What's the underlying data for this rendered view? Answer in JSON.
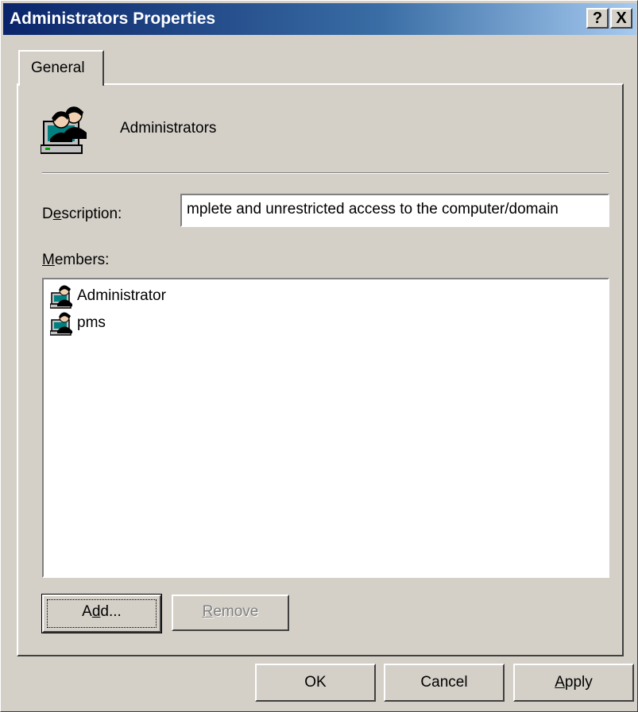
{
  "window": {
    "title": "Administrators Properties",
    "help_button": "?",
    "close_button": "X"
  },
  "tabs": [
    {
      "label": "General",
      "selected": true
    }
  ],
  "general": {
    "group_name": "Administrators",
    "group_icon": "user-group-icon",
    "description_label": "Description:",
    "description_value": "mplete and unrestricted access to the computer/domain",
    "members_label": "Members:",
    "members": [
      {
        "name": "Administrator",
        "icon": "user-icon"
      },
      {
        "name": "pms",
        "icon": "user-icon"
      }
    ],
    "add_button": "Add...",
    "remove_button": "Remove",
    "remove_enabled": false
  },
  "footer": {
    "ok": "OK",
    "cancel": "Cancel",
    "apply": "Apply"
  },
  "colors": {
    "face": "#d4d0c8",
    "title_start": "#0a246a",
    "title_end": "#a6caf0",
    "disabled_text": "#808080"
  }
}
